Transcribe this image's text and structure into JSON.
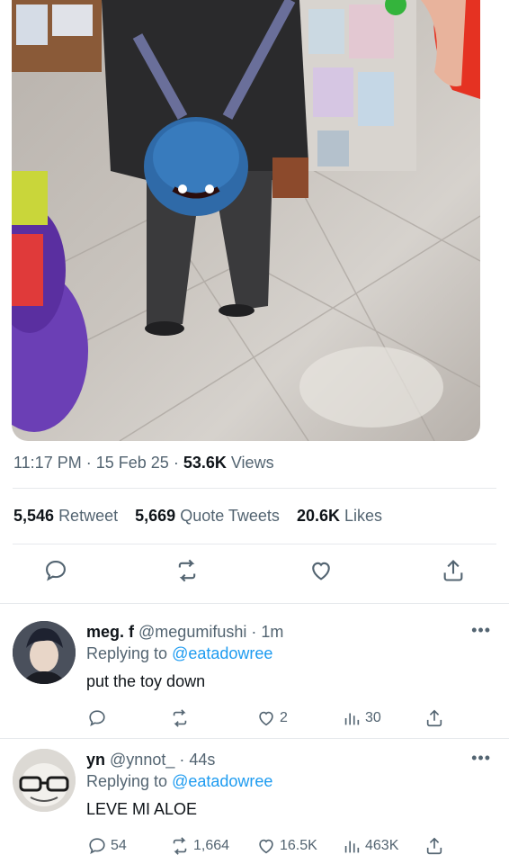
{
  "tweet": {
    "time": "11:17 PM",
    "date": "15 Feb 25",
    "views_count": "53.6K",
    "views_label": "Views",
    "retweets_count": "5,546",
    "retweets_label": "Retweet",
    "quotes_count": "5,669",
    "quotes_label": "Quote Tweets",
    "likes_count": "20.6K",
    "likes_label": "Likes"
  },
  "replies": [
    {
      "name": "meg. f",
      "handle": "@megumifushi",
      "time": "1m",
      "replying_label": "Replying to",
      "replying_to": "@eatadowree",
      "text": "put the toy down",
      "like_count": "2",
      "views_count": "30"
    },
    {
      "name": "yn",
      "handle": "@ynnot_",
      "time": "44s",
      "replying_label": "Replying to",
      "replying_to": "@eatadowree",
      "text": "LEVE MI ALOE",
      "reply_count": "54",
      "retweet_count": "1,664",
      "like_count": "16.5K",
      "views_count": "463K"
    }
  ],
  "colors": {
    "text": "#0f1419",
    "secondary": "#536471",
    "link": "#1d9bf0",
    "divider": "#e6e9ec"
  }
}
